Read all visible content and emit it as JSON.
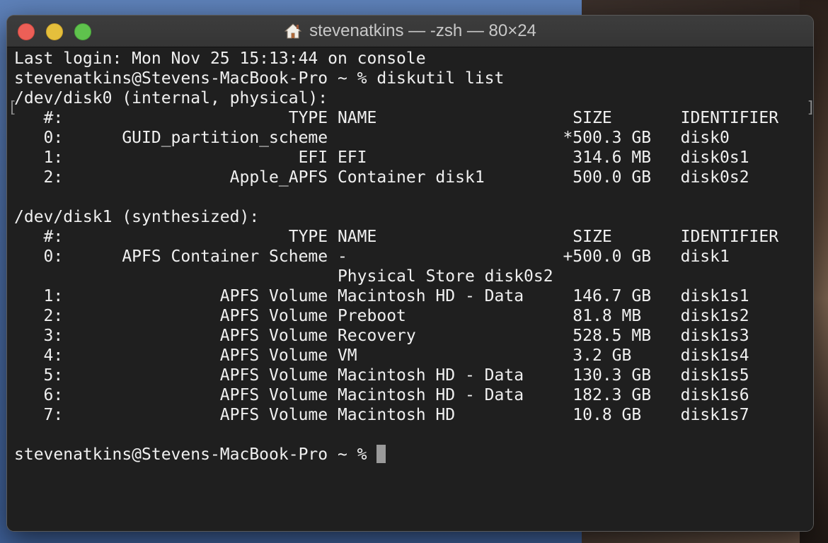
{
  "window": {
    "title": "stevenatkins — -zsh — 80×24",
    "colors": {
      "close": "#ec5f57",
      "minimize": "#e5bf3c",
      "zoom": "#5fc24d",
      "background": "#1f1f1f",
      "text": "#f0f0f0"
    }
  },
  "terminal": {
    "lines": [
      "Last login: Mon Nov 25 15:13:44 on console",
      "stevenatkins@Stevens-MacBook-Pro ~ % diskutil list",
      "/dev/disk0 (internal, physical):",
      "   #:                       TYPE NAME                    SIZE       IDENTIFIER",
      "   0:      GUID_partition_scheme                        *500.3 GB   disk0",
      "   1:                        EFI EFI                     314.6 MB   disk0s1",
      "   2:                 Apple_APFS Container disk1         500.0 GB   disk0s2",
      "",
      "/dev/disk1 (synthesized):",
      "   #:                       TYPE NAME                    SIZE       IDENTIFIER",
      "   0:      APFS Container Scheme -                      +500.0 GB   disk1",
      "                                 Physical Store disk0s2",
      "   1:                APFS Volume Macintosh HD - Data     146.7 GB   disk1s1",
      "   2:                APFS Volume Preboot                 81.8 MB    disk1s2",
      "   3:                APFS Volume Recovery                528.5 MB   disk1s3",
      "   4:                APFS Volume VM                      3.2 GB     disk1s4",
      "   5:                APFS Volume Macintosh HD - Data     130.3 GB   disk1s5",
      "   6:                APFS Volume Macintosh HD - Data     182.3 GB   disk1s6",
      "   7:                APFS Volume Macintosh HD            10.8 GB    disk1s7",
      ""
    ],
    "prompt": "stevenatkins@Stevens-MacBook-Pro ~ % "
  }
}
